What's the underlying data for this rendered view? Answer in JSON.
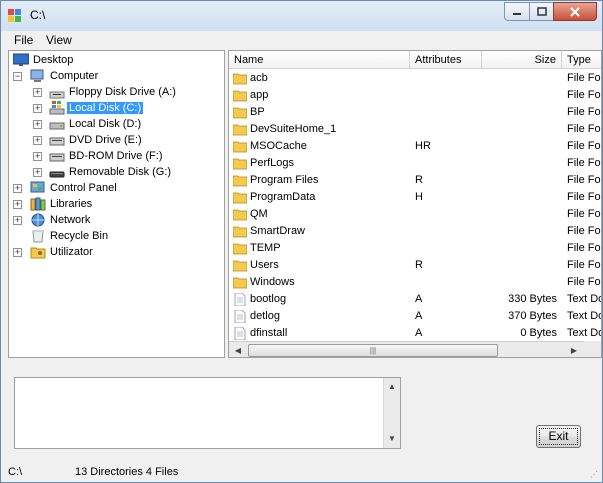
{
  "window": {
    "title": "C:\\"
  },
  "menu": {
    "items": [
      "File",
      "View"
    ]
  },
  "tree": {
    "nodes": [
      {
        "label": "Desktop",
        "icon": "desktop-icon"
      },
      {
        "label": "Computer",
        "icon": "computer-icon"
      },
      {
        "label": "Floppy Disk Drive (A:)",
        "icon": "floppy-drive-icon"
      },
      {
        "label": "Local Disk (C:)",
        "icon": "windows-disk-icon",
        "selected": true
      },
      {
        "label": "Local Disk (D:)",
        "icon": "hard-disk-icon"
      },
      {
        "label": "DVD Drive (E:)",
        "icon": "dvd-drive-icon"
      },
      {
        "label": "BD-ROM Drive (F:)",
        "icon": "bdrom-drive-icon"
      },
      {
        "label": "Removable Disk (G:)",
        "icon": "removable-disk-icon"
      },
      {
        "label": "Control Panel",
        "icon": "control-panel-icon"
      },
      {
        "label": "Libraries",
        "icon": "libraries-icon"
      },
      {
        "label": "Network",
        "icon": "network-icon"
      },
      {
        "label": "Recycle Bin",
        "icon": "recycle-bin-icon"
      },
      {
        "label": "Utilizator",
        "icon": "user-folder-icon"
      }
    ]
  },
  "list": {
    "columns": [
      "Name",
      "Attributes",
      "Size",
      "Type"
    ],
    "rows": [
      {
        "name": "acb",
        "attributes": "",
        "size": "",
        "type": "File Folder",
        "icon": "folder-icon"
      },
      {
        "name": "app",
        "attributes": "",
        "size": "",
        "type": "File Folder",
        "icon": "folder-icon"
      },
      {
        "name": "BP",
        "attributes": "",
        "size": "",
        "type": "File Folder",
        "icon": "folder-icon"
      },
      {
        "name": "DevSuiteHome_1",
        "attributes": "",
        "size": "",
        "type": "File Folder",
        "icon": "folder-icon"
      },
      {
        "name": "MSOCache",
        "attributes": "HR",
        "size": "",
        "type": "File Folder",
        "icon": "folder-icon"
      },
      {
        "name": "PerfLogs",
        "attributes": "",
        "size": "",
        "type": "File Folder",
        "icon": "folder-icon"
      },
      {
        "name": "Program Files",
        "attributes": "R",
        "size": "",
        "type": "File Folder",
        "icon": "folder-icon"
      },
      {
        "name": "ProgramData",
        "attributes": "H",
        "size": "",
        "type": "File Folder",
        "icon": "folder-icon"
      },
      {
        "name": "QM",
        "attributes": "",
        "size": "",
        "type": "File Folder",
        "icon": "folder-icon"
      },
      {
        "name": "SmartDraw",
        "attributes": "",
        "size": "",
        "type": "File Folder",
        "icon": "folder-icon"
      },
      {
        "name": "TEMP",
        "attributes": "",
        "size": "",
        "type": "File Folder",
        "icon": "folder-icon"
      },
      {
        "name": "Users",
        "attributes": "R",
        "size": "",
        "type": "File Folder",
        "icon": "folder-icon"
      },
      {
        "name": "Windows",
        "attributes": "",
        "size": "",
        "type": "File Folder",
        "icon": "folder-icon"
      },
      {
        "name": "bootlog",
        "attributes": "A",
        "size": "330 Bytes",
        "type": "Text Document",
        "icon": "text-file-icon"
      },
      {
        "name": "detlog",
        "attributes": "A",
        "size": "370 Bytes",
        "type": "Text Document",
        "icon": "text-file-icon"
      },
      {
        "name": "dfinstall",
        "attributes": "A",
        "size": "0 Bytes",
        "type": "Text Document",
        "icon": "text-file-icon"
      }
    ]
  },
  "textarea": {
    "value": ""
  },
  "buttons": {
    "exit": "Exit"
  },
  "status": {
    "path": "C:\\",
    "summary": "13 Directories 4 Files"
  },
  "colors": {
    "selection": "#3399ff",
    "folder": "#f3c94f"
  }
}
